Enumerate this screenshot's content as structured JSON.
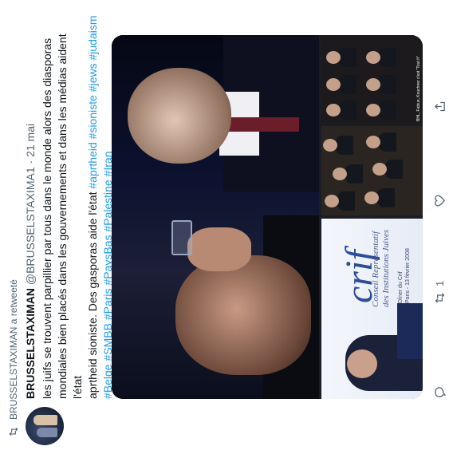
{
  "tweet": {
    "retweeted_by": "BRUSSELSTAXIMAN a retweeté",
    "author_name": "BRUSSELSTAXIMAN",
    "author_handle": "@BRUSSELSTAXIMA1",
    "separator": "·",
    "date": "21 mai",
    "text_lines": [
      "les juifs se trouvent parpillier par tous dans le monde alors des diasporas",
      "mondiales bien placés dans les gouvernements et dans les médias aident l'état",
      "aprtheid sioniste. Des gasporas  aide l'état "
    ],
    "hashtags_line3": "#aprtheid #sioniste #jews #judaism",
    "hashtags_line4": "#Belge #SMBB #Paris #PaysBas #Palestine #Iran",
    "media": {
      "crif_logo": "crif",
      "crif_subtitle": "Conseil Représentatif des Institutions Juives",
      "crif_event": "Dîner du Crif",
      "crif_event_date": "Paris - 13 février 2008",
      "caption_right": "BHL, Fabius, Kouchner c'est \"Tout.fr\""
    },
    "actions": {
      "reply_count": "",
      "retweet_count": "1",
      "like_count": "",
      "share_count": ""
    }
  }
}
